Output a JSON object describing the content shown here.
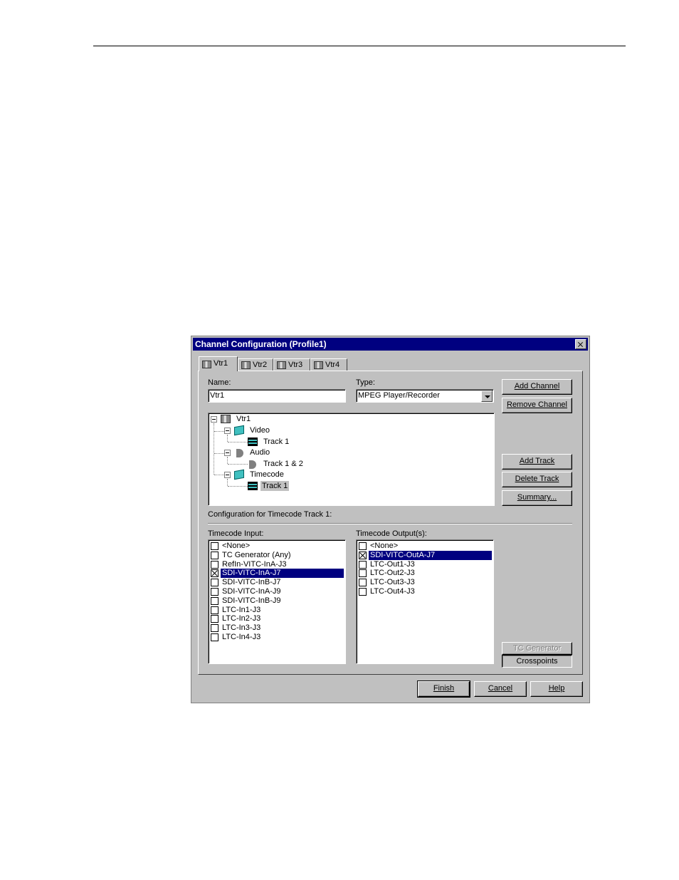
{
  "dialog": {
    "title": "Channel Configuration (Profile1)",
    "tabs": [
      "Vtr1",
      "Vtr2",
      "Vtr3",
      "Vtr4"
    ],
    "active_tab": "Vtr1",
    "name_label": "Name:",
    "name_value": "Vtr1",
    "type_label": "Type:",
    "type_value": "MPEG Player/Recorder",
    "buttons": {
      "add_channel": "Add Channel",
      "remove_channel": "Remove Channel",
      "add_track": "Add Track",
      "delete_track": "Delete Track",
      "summary": "Summary...",
      "tc_generator": "TC Generator",
      "crosspoints": "Crosspoints",
      "finish": "Finish",
      "cancel": "Cancel",
      "help": "Help"
    },
    "tree": {
      "root": "Vtr1",
      "video": "Video",
      "video_track": "Track 1",
      "audio": "Audio",
      "audio_track": "Track 1 & 2",
      "timecode": "Timecode",
      "timecode_track": "Track 1"
    },
    "config_label": "Configuration for Timecode Track 1:",
    "input_label": "Timecode Input:",
    "output_label": "Timecode Output(s):",
    "inputs": [
      {
        "label": "<None>",
        "checked": false
      },
      {
        "label": "TC Generator (Any)",
        "checked": false
      },
      {
        "label": "RefIn-VITC-InA-J3",
        "checked": false
      },
      {
        "label": "SDI-VITC-InA-J7",
        "checked": true
      },
      {
        "label": "SDI-VITC-InB-J7",
        "checked": false
      },
      {
        "label": "SDI-VITC-InA-J9",
        "checked": false
      },
      {
        "label": "SDI-VITC-InB-J9",
        "checked": false
      },
      {
        "label": "LTC-In1-J3",
        "checked": false
      },
      {
        "label": "LTC-In2-J3",
        "checked": false
      },
      {
        "label": "LTC-In3-J3",
        "checked": false
      },
      {
        "label": "LTC-In4-J3",
        "checked": false
      }
    ],
    "outputs": [
      {
        "label": "<None>",
        "checked": false
      },
      {
        "label": "SDI-VITC-OutA-J7",
        "checked": true
      },
      {
        "label": "LTC-Out1-J3",
        "checked": false
      },
      {
        "label": "LTC-Out2-J3",
        "checked": false
      },
      {
        "label": "LTC-Out3-J3",
        "checked": false
      },
      {
        "label": "LTC-Out4-J3",
        "checked": false
      }
    ]
  }
}
